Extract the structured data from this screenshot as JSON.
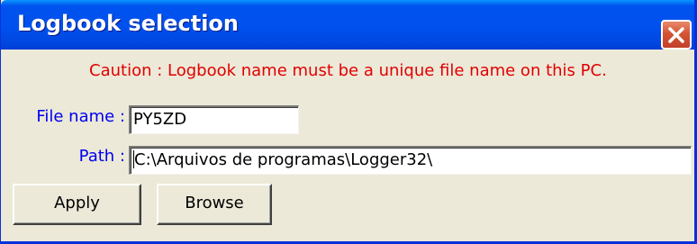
{
  "window": {
    "title": "Logbook selection",
    "close_icon": "close-icon"
  },
  "caution": {
    "text": "Caution : Logbook name must be a unique file name on this PC.",
    "color": "#e10000"
  },
  "form": {
    "file_name_label": "File name :",
    "file_name_value": "PY5ZD",
    "path_label": "Path :",
    "path_value": "C:\\Arquivos de programas\\Logger32\\",
    "label_color": "#0000f0"
  },
  "buttons": {
    "apply_label": "Apply",
    "browse_label": "Browse"
  },
  "colors": {
    "titlebar": "#0053ee",
    "window_face": "#ece9d8",
    "close_button": "#d45534"
  }
}
